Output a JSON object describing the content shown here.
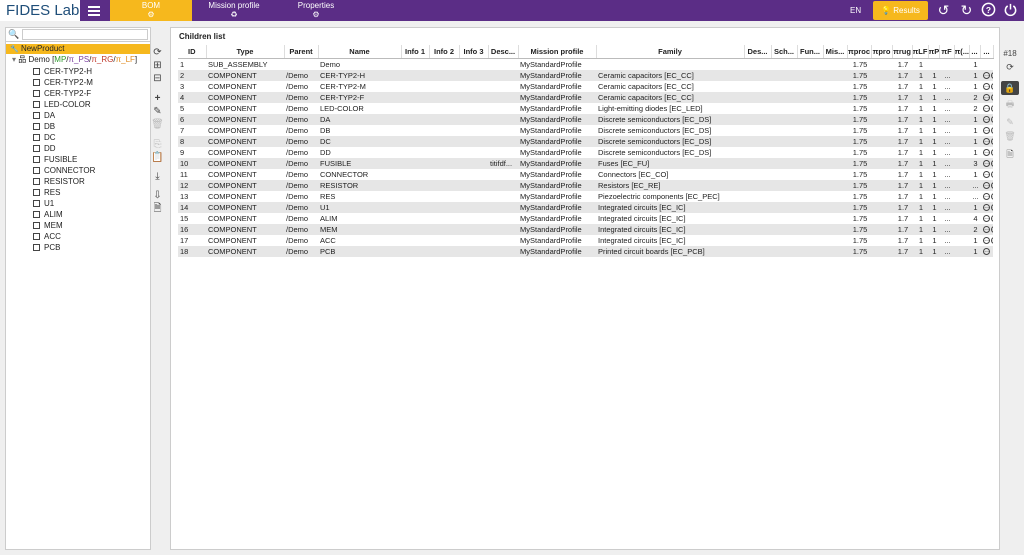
{
  "app": {
    "logo": "FIDES Lab",
    "lang": "EN",
    "results_label": "Results"
  },
  "nav": [
    {
      "label": "BOM",
      "icon": "⚙",
      "active": true
    },
    {
      "label": "Mission profile",
      "icon": "♻",
      "active": false
    },
    {
      "label": "Properties",
      "icon": "⚙",
      "active": false
    }
  ],
  "tree": {
    "search_placeholder": "",
    "root": "NewProduct",
    "demo_label": "Demo",
    "demo_tags": {
      "open": "[",
      "mp": "MP",
      "s1": "/",
      "ps": "π_PS",
      "s2": "/",
      "rg": "π_RG",
      "s3": "/",
      "lf": "π_LF",
      "close": "]"
    },
    "items": [
      "CER-TYP2-H",
      "CER-TYP2-M",
      "CER-TYP2-F",
      "LED-COLOR",
      "DA",
      "DB",
      "DC",
      "DD",
      "FUSIBLE",
      "CONNECTOR",
      "RESISTOR",
      "RES",
      "U1",
      "ALIM",
      "MEM",
      "ACC",
      "PCB"
    ]
  },
  "main": {
    "title": "Children list",
    "row_count": "#18",
    "columns": [
      "ID",
      "Type",
      "Parent",
      "Name",
      "Info 1",
      "Info 2",
      "Info 3",
      "Desc...",
      "Mission profile",
      "Family",
      "Des...",
      "Sch...",
      "Fun...",
      "Mis...",
      "πproc",
      "πpro",
      "πrug",
      "πLF",
      "πP",
      "πF",
      "π(...",
      "...",
      "..."
    ],
    "rows": [
      [
        "1",
        "SUB_ASSEMBLY",
        "",
        "Demo",
        "",
        "",
        "",
        "",
        "MyStandardProfile",
        "",
        "",
        "",
        "",
        "",
        "1.75",
        "",
        "1.7",
        "1",
        "",
        "",
        "",
        "1",
        ""
      ],
      [
        "2",
        "COMPONENT",
        "/Demo",
        "CER-TYP2-H",
        "",
        "",
        "",
        "",
        "MyStandardProfile",
        "Ceramic capacitors [EC_CC]",
        "",
        "",
        "",
        "",
        "1.75",
        "",
        "1.7",
        "1",
        "1",
        "...",
        "",
        "1",
        ""
      ],
      [
        "3",
        "COMPONENT",
        "/Demo",
        "CER-TYP2-M",
        "",
        "",
        "",
        "",
        "MyStandardProfile",
        "Ceramic capacitors [EC_CC]",
        "",
        "",
        "",
        "",
        "1.75",
        "",
        "1.7",
        "1",
        "1",
        "...",
        "",
        "1",
        ""
      ],
      [
        "4",
        "COMPONENT",
        "/Demo",
        "CER-TYP2-F",
        "",
        "",
        "",
        "",
        "MyStandardProfile",
        "Ceramic capacitors [EC_CC]",
        "",
        "",
        "",
        "",
        "1.75",
        "",
        "1.7",
        "1",
        "1",
        "...",
        "",
        "2",
        ""
      ],
      [
        "5",
        "COMPONENT",
        "/Demo",
        "LED-COLOR",
        "",
        "",
        "",
        "",
        "MyStandardProfile",
        "Light-emitting diodes [EC_LED]",
        "",
        "",
        "",
        "",
        "1.75",
        "",
        "1.7",
        "1",
        "1",
        "...",
        "",
        "2",
        ""
      ],
      [
        "6",
        "COMPONENT",
        "/Demo",
        "DA",
        "",
        "",
        "",
        "",
        "MyStandardProfile",
        "Discrete semiconductors [EC_DS]",
        "",
        "",
        "",
        "",
        "1.75",
        "",
        "1.7",
        "1",
        "1",
        "...",
        "",
        "1",
        ""
      ],
      [
        "7",
        "COMPONENT",
        "/Demo",
        "DB",
        "",
        "",
        "",
        "",
        "MyStandardProfile",
        "Discrete semiconductors [EC_DS]",
        "",
        "",
        "",
        "",
        "1.75",
        "",
        "1.7",
        "1",
        "1",
        "...",
        "",
        "1",
        ""
      ],
      [
        "8",
        "COMPONENT",
        "/Demo",
        "DC",
        "",
        "",
        "",
        "",
        "MyStandardProfile",
        "Discrete semiconductors [EC_DS]",
        "",
        "",
        "",
        "",
        "1.75",
        "",
        "1.7",
        "1",
        "1",
        "...",
        "",
        "1",
        ""
      ],
      [
        "9",
        "COMPONENT",
        "/Demo",
        "DD",
        "",
        "",
        "",
        "",
        "MyStandardProfile",
        "Discrete semiconductors [EC_DS]",
        "",
        "",
        "",
        "",
        "1.75",
        "",
        "1.7",
        "1",
        "1",
        "...",
        "",
        "1",
        ""
      ],
      [
        "10",
        "COMPONENT",
        "/Demo",
        "FUSIBLE",
        "",
        "",
        "",
        "titifdf...",
        "MyStandardProfile",
        "Fuses [EC_FU]",
        "",
        "",
        "",
        "",
        "1.75",
        "",
        "1.7",
        "1",
        "1",
        "...",
        "",
        "3",
        ""
      ],
      [
        "11",
        "COMPONENT",
        "/Demo",
        "CONNECTOR",
        "",
        "",
        "",
        "",
        "MyStandardProfile",
        "Connectors [EC_CO]",
        "",
        "",
        "",
        "",
        "1.75",
        "",
        "1.7",
        "1",
        "1",
        "...",
        "",
        "1",
        ""
      ],
      [
        "12",
        "COMPONENT",
        "/Demo",
        "RESISTOR",
        "",
        "",
        "",
        "",
        "MyStandardProfile",
        "Resistors [EC_RE]",
        "",
        "",
        "",
        "",
        "1.75",
        "",
        "1.7",
        "1",
        "1",
        "...",
        "",
        "...",
        ""
      ],
      [
        "13",
        "COMPONENT",
        "/Demo",
        "RES",
        "",
        "",
        "",
        "",
        "MyStandardProfile",
        "Piezoelectric components [EC_PEC]",
        "",
        "",
        "",
        "",
        "1.75",
        "",
        "1.7",
        "1",
        "1",
        "...",
        "",
        "...",
        ""
      ],
      [
        "14",
        "COMPONENT",
        "/Demo",
        "U1",
        "",
        "",
        "",
        "",
        "MyStandardProfile",
        "Integrated circuits [EC_IC]",
        "",
        "",
        "",
        "",
        "1.75",
        "",
        "1.7",
        "1",
        "1",
        "...",
        "",
        "1",
        ""
      ],
      [
        "15",
        "COMPONENT",
        "/Demo",
        "ALIM",
        "",
        "",
        "",
        "",
        "MyStandardProfile",
        "Integrated circuits [EC_IC]",
        "",
        "",
        "",
        "",
        "1.75",
        "",
        "1.7",
        "1",
        "1",
        "...",
        "",
        "4",
        ""
      ],
      [
        "16",
        "COMPONENT",
        "/Demo",
        "MEM",
        "",
        "",
        "",
        "",
        "MyStandardProfile",
        "Integrated circuits [EC_IC]",
        "",
        "",
        "",
        "",
        "1.75",
        "",
        "1.7",
        "1",
        "1",
        "...",
        "",
        "2",
        ""
      ],
      [
        "17",
        "COMPONENT",
        "/Demo",
        "ACC",
        "",
        "",
        "",
        "",
        "MyStandardProfile",
        "Integrated circuits [EC_IC]",
        "",
        "",
        "",
        "",
        "1.75",
        "",
        "1.7",
        "1",
        "1",
        "...",
        "",
        "1",
        ""
      ],
      [
        "18",
        "COMPONENT",
        "/Demo",
        "PCB",
        "",
        "",
        "",
        "",
        "MyStandardProfile",
        "Printed circuit boards [EC_PCB]",
        "",
        "",
        "",
        "",
        "1.75",
        "",
        "1.7",
        "1",
        "1",
        "...",
        "",
        "1",
        ""
      ]
    ]
  },
  "colors": {
    "brand_purple": "#5b2d86",
    "accent_yellow": "#f6b81d",
    "mp_green": "#2e9a2e",
    "ps_purple": "#7b3fa0",
    "rg_red": "#c0392b",
    "lf_orange": "#e08a1e"
  }
}
